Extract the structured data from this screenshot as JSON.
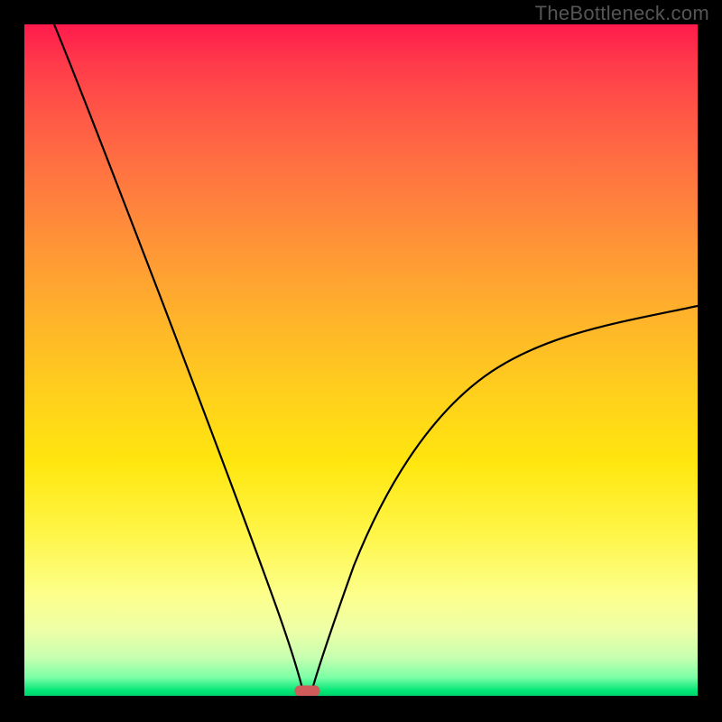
{
  "watermark": "TheBottleneck.com",
  "colors": {
    "background": "#000000",
    "gradient_top": "#ff1b4d",
    "gradient_mid": "#ffd01c",
    "gradient_bottom": "#00cc66",
    "curve": "#000000",
    "marker": "#cf5b5b"
  },
  "chart_data": {
    "type": "line",
    "title": "",
    "xlabel": "",
    "ylabel": "",
    "xlim": [
      0,
      100
    ],
    "ylim": [
      0,
      100
    ],
    "grid": false,
    "legend": false,
    "description": "V-shaped bottleneck curve over vertical red-to-green heat gradient. Minimum (green marker) near x≈42. Left branch rises steeply toward the top-left corner; right branch rises more gently, exiting near top-right around y≈58.",
    "minimum_at_x": 41.8,
    "minimum_value": 0,
    "left_branch": {
      "x": [
        0,
        5,
        10,
        15,
        20,
        25,
        30,
        35,
        40,
        41.8
      ],
      "y": [
        100,
        91,
        81,
        71,
        60,
        49,
        37,
        24,
        7,
        0
      ]
    },
    "right_branch": {
      "x": [
        41.8,
        44,
        48,
        52,
        56,
        60,
        65,
        70,
        75,
        80,
        85,
        90,
        95,
        100
      ],
      "y": [
        0,
        6,
        15,
        22,
        28,
        33,
        38,
        42,
        46,
        49,
        52,
        54,
        56,
        58
      ]
    },
    "marker": {
      "x": 41.8,
      "y": 0.5,
      "width": 3.6,
      "height": 1.6,
      "shape": "rounded-rect"
    }
  }
}
